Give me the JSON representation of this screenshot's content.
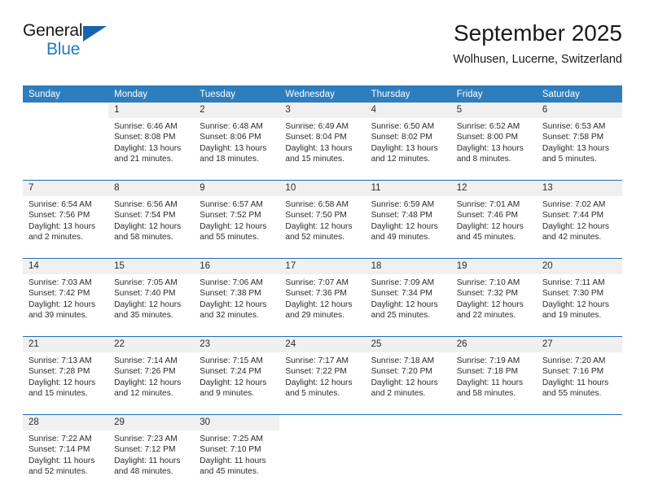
{
  "brand": {
    "name_top": "General",
    "name_bottom": "Blue",
    "logo_icon": "triangle-icon",
    "color_blue": "#1f7bc1",
    "color_triangle": "#1565ae"
  },
  "header": {
    "month_title": "September 2025",
    "location": "Wolhusen, Lucerne, Switzerland"
  },
  "calendar": {
    "header_color": "#2e7ebd",
    "daynum_band_color": "#f0f0f0",
    "week_divider_color": "#1f6db5",
    "weekdays": [
      "Sunday",
      "Monday",
      "Tuesday",
      "Wednesday",
      "Thursday",
      "Friday",
      "Saturday"
    ],
    "weeks": [
      [
        {
          "day": "",
          "lines": []
        },
        {
          "day": "1",
          "lines": [
            "Sunrise: 6:46 AM",
            "Sunset: 8:08 PM",
            "Daylight: 13 hours",
            "and 21 minutes."
          ]
        },
        {
          "day": "2",
          "lines": [
            "Sunrise: 6:48 AM",
            "Sunset: 8:06 PM",
            "Daylight: 13 hours",
            "and 18 minutes."
          ]
        },
        {
          "day": "3",
          "lines": [
            "Sunrise: 6:49 AM",
            "Sunset: 8:04 PM",
            "Daylight: 13 hours",
            "and 15 minutes."
          ]
        },
        {
          "day": "4",
          "lines": [
            "Sunrise: 6:50 AM",
            "Sunset: 8:02 PM",
            "Daylight: 13 hours",
            "and 12 minutes."
          ]
        },
        {
          "day": "5",
          "lines": [
            "Sunrise: 6:52 AM",
            "Sunset: 8:00 PM",
            "Daylight: 13 hours",
            "and 8 minutes."
          ]
        },
        {
          "day": "6",
          "lines": [
            "Sunrise: 6:53 AM",
            "Sunset: 7:58 PM",
            "Daylight: 13 hours",
            "and 5 minutes."
          ]
        }
      ],
      [
        {
          "day": "7",
          "lines": [
            "Sunrise: 6:54 AM",
            "Sunset: 7:56 PM",
            "Daylight: 13 hours",
            "and 2 minutes."
          ]
        },
        {
          "day": "8",
          "lines": [
            "Sunrise: 6:56 AM",
            "Sunset: 7:54 PM",
            "Daylight: 12 hours",
            "and 58 minutes."
          ]
        },
        {
          "day": "9",
          "lines": [
            "Sunrise: 6:57 AM",
            "Sunset: 7:52 PM",
            "Daylight: 12 hours",
            "and 55 minutes."
          ]
        },
        {
          "day": "10",
          "lines": [
            "Sunrise: 6:58 AM",
            "Sunset: 7:50 PM",
            "Daylight: 12 hours",
            "and 52 minutes."
          ]
        },
        {
          "day": "11",
          "lines": [
            "Sunrise: 6:59 AM",
            "Sunset: 7:48 PM",
            "Daylight: 12 hours",
            "and 49 minutes."
          ]
        },
        {
          "day": "12",
          "lines": [
            "Sunrise: 7:01 AM",
            "Sunset: 7:46 PM",
            "Daylight: 12 hours",
            "and 45 minutes."
          ]
        },
        {
          "day": "13",
          "lines": [
            "Sunrise: 7:02 AM",
            "Sunset: 7:44 PM",
            "Daylight: 12 hours",
            "and 42 minutes."
          ]
        }
      ],
      [
        {
          "day": "14",
          "lines": [
            "Sunrise: 7:03 AM",
            "Sunset: 7:42 PM",
            "Daylight: 12 hours",
            "and 39 minutes."
          ]
        },
        {
          "day": "15",
          "lines": [
            "Sunrise: 7:05 AM",
            "Sunset: 7:40 PM",
            "Daylight: 12 hours",
            "and 35 minutes."
          ]
        },
        {
          "day": "16",
          "lines": [
            "Sunrise: 7:06 AM",
            "Sunset: 7:38 PM",
            "Daylight: 12 hours",
            "and 32 minutes."
          ]
        },
        {
          "day": "17",
          "lines": [
            "Sunrise: 7:07 AM",
            "Sunset: 7:36 PM",
            "Daylight: 12 hours",
            "and 29 minutes."
          ]
        },
        {
          "day": "18",
          "lines": [
            "Sunrise: 7:09 AM",
            "Sunset: 7:34 PM",
            "Daylight: 12 hours",
            "and 25 minutes."
          ]
        },
        {
          "day": "19",
          "lines": [
            "Sunrise: 7:10 AM",
            "Sunset: 7:32 PM",
            "Daylight: 12 hours",
            "and 22 minutes."
          ]
        },
        {
          "day": "20",
          "lines": [
            "Sunrise: 7:11 AM",
            "Sunset: 7:30 PM",
            "Daylight: 12 hours",
            "and 19 minutes."
          ]
        }
      ],
      [
        {
          "day": "21",
          "lines": [
            "Sunrise: 7:13 AM",
            "Sunset: 7:28 PM",
            "Daylight: 12 hours",
            "and 15 minutes."
          ]
        },
        {
          "day": "22",
          "lines": [
            "Sunrise: 7:14 AM",
            "Sunset: 7:26 PM",
            "Daylight: 12 hours",
            "and 12 minutes."
          ]
        },
        {
          "day": "23",
          "lines": [
            "Sunrise: 7:15 AM",
            "Sunset: 7:24 PM",
            "Daylight: 12 hours",
            "and 9 minutes."
          ]
        },
        {
          "day": "24",
          "lines": [
            "Sunrise: 7:17 AM",
            "Sunset: 7:22 PM",
            "Daylight: 12 hours",
            "and 5 minutes."
          ]
        },
        {
          "day": "25",
          "lines": [
            "Sunrise: 7:18 AM",
            "Sunset: 7:20 PM",
            "Daylight: 12 hours",
            "and 2 minutes."
          ]
        },
        {
          "day": "26",
          "lines": [
            "Sunrise: 7:19 AM",
            "Sunset: 7:18 PM",
            "Daylight: 11 hours",
            "and 58 minutes."
          ]
        },
        {
          "day": "27",
          "lines": [
            "Sunrise: 7:20 AM",
            "Sunset: 7:16 PM",
            "Daylight: 11 hours",
            "and 55 minutes."
          ]
        }
      ],
      [
        {
          "day": "28",
          "lines": [
            "Sunrise: 7:22 AM",
            "Sunset: 7:14 PM",
            "Daylight: 11 hours",
            "and 52 minutes."
          ]
        },
        {
          "day": "29",
          "lines": [
            "Sunrise: 7:23 AM",
            "Sunset: 7:12 PM",
            "Daylight: 11 hours",
            "and 48 minutes."
          ]
        },
        {
          "day": "30",
          "lines": [
            "Sunrise: 7:25 AM",
            "Sunset: 7:10 PM",
            "Daylight: 11 hours",
            "and 45 minutes."
          ]
        },
        {
          "day": "",
          "lines": []
        },
        {
          "day": "",
          "lines": []
        },
        {
          "day": "",
          "lines": []
        },
        {
          "day": "",
          "lines": []
        }
      ]
    ]
  }
}
